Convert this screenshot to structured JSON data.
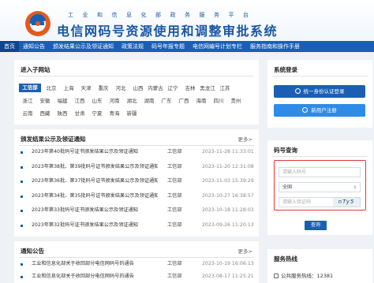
{
  "header": {
    "subtitle": "工业和信息化部政务服务平台",
    "title": "电信网码号资源使用和调整审批系统"
  },
  "nav": {
    "items": [
      {
        "label": "首页",
        "active": true
      },
      {
        "label": "通知公告"
      },
      {
        "label": "颁发结果公示及领证通知"
      },
      {
        "label": "政策法规"
      },
      {
        "label": "码号年报专题"
      },
      {
        "label": "电信网编号计划专栏"
      },
      {
        "label": "服务指南和操作手册"
      }
    ]
  },
  "subsites": {
    "title": "进入子网站",
    "rows": [
      [
        "工信部",
        "北京",
        "上海",
        "天津",
        "重庆",
        "河北",
        "山西",
        "内蒙古",
        "辽宁",
        "吉林",
        "黑龙江",
        "江苏"
      ],
      [
        "浙江",
        "安徽",
        "福建",
        "江西",
        "山东",
        "河南",
        "湖北",
        "湖南",
        "广东",
        "广西",
        "海南",
        "四川",
        "贵州"
      ],
      [
        "云南",
        "西藏",
        "陕西",
        "甘肃",
        "宁夏",
        "青海",
        "新疆"
      ]
    ]
  },
  "results": {
    "title": "颁发结果公示及领证通知",
    "more": "更多>",
    "items": [
      {
        "title": "2023年第40批码号证书颁发结果公示及领证通知",
        "dept": "工信部",
        "time": "2023-11-28 11:33:01"
      },
      {
        "title": "2023年第38批、第39批码号证书颁发结果公示及领证通知",
        "dept": "工信部",
        "time": "2023-11-20 12:31:08"
      },
      {
        "title": "2023年第36批、第37批码号证书颁发结果公示及领证通知",
        "dept": "工信部",
        "time": "2023-11-03 15:39:29"
      },
      {
        "title": "2023年第34批、第35批码号证书颁发结果公示及领证通知",
        "dept": "工信部",
        "time": "2023-10-27 16:38:57"
      },
      {
        "title": "2023年第33批码号证书颁发结果公示及领证通知",
        "dept": "工信部",
        "time": "2023-10-18 11:28:03"
      },
      {
        "title": "2023年第32批码号证书颁发结果公示及领证通知",
        "dept": "工信部",
        "time": "2023-09-26 11:20:13"
      }
    ]
  },
  "notices": {
    "title": "通知公告",
    "more": "更多>",
    "items": [
      {
        "title": "工业和信息化部关于收回部分电信网码号的通告",
        "dept": "工信部",
        "time": "2023-10-19 16:06:13"
      },
      {
        "title": "工业和信息化部关于收回部分电信网码号的通告",
        "dept": "工信部",
        "time": "2023-08-17 11:25:21"
      }
    ]
  },
  "login": {
    "title": "系统登录",
    "unified_label": "统一身份认证登录",
    "register_label": "新用户注册",
    "unified_color": "#1a5fb4",
    "register_color": "#2e8be6"
  },
  "query": {
    "title": "码号查询",
    "code_placeholder": "请输入码号",
    "region_value": "全国",
    "captcha_placeholder": "请输入验证码",
    "captcha_text": "nTy5",
    "button_label": "查询",
    "highlight_color": "#e53935"
  },
  "hotline": {
    "title": "服务热线",
    "text": "公共服务热线：12381"
  }
}
